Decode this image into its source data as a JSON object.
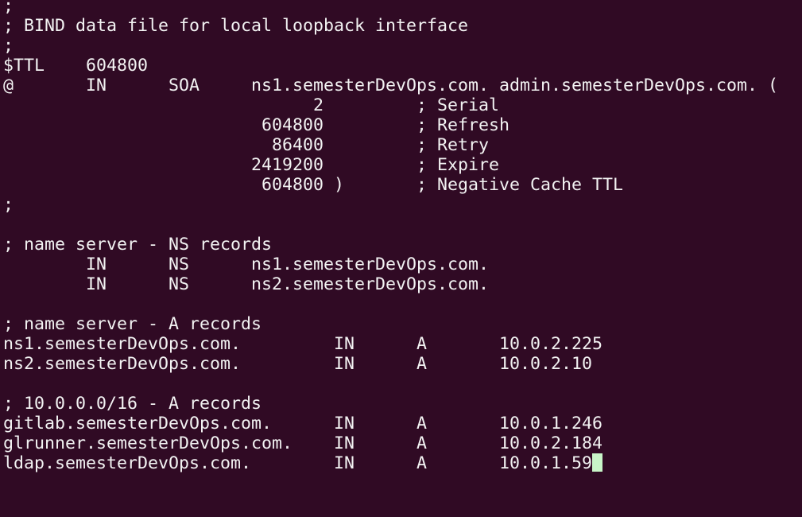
{
  "terminal": {
    "lines": [
      ";",
      "; BIND data file for local loopback interface",
      ";",
      "$TTL    604800",
      "@       IN      SOA     ns1.semesterDevOps.com. admin.semesterDevOps.com. (",
      "                              2         ; Serial",
      "                         604800         ; Refresh",
      "                          86400         ; Retry",
      "                        2419200         ; Expire",
      "                         604800 )       ; Negative Cache TTL",
      ";",
      "",
      "; name server - NS records",
      "        IN      NS      ns1.semesterDevOps.com.",
      "        IN      NS      ns2.semesterDevOps.com.",
      "",
      "; name server - A records",
      "ns1.semesterDevOps.com.         IN      A       10.0.2.225",
      "ns2.semesterDevOps.com.         IN      A       10.0.2.10",
      "",
      "; 10.0.0.0/16 - A records",
      "gitlab.semesterDevOps.com.      IN      A       10.0.1.246",
      "glrunner.semesterDevOps.com.    IN      A       10.0.2.184",
      "ldap.semesterDevOps.com.        IN      A       10.0.1.59"
    ]
  },
  "colors": {
    "background": "#300a24",
    "foreground": "#f2f2f2",
    "cursor": "#c8f5c8"
  }
}
